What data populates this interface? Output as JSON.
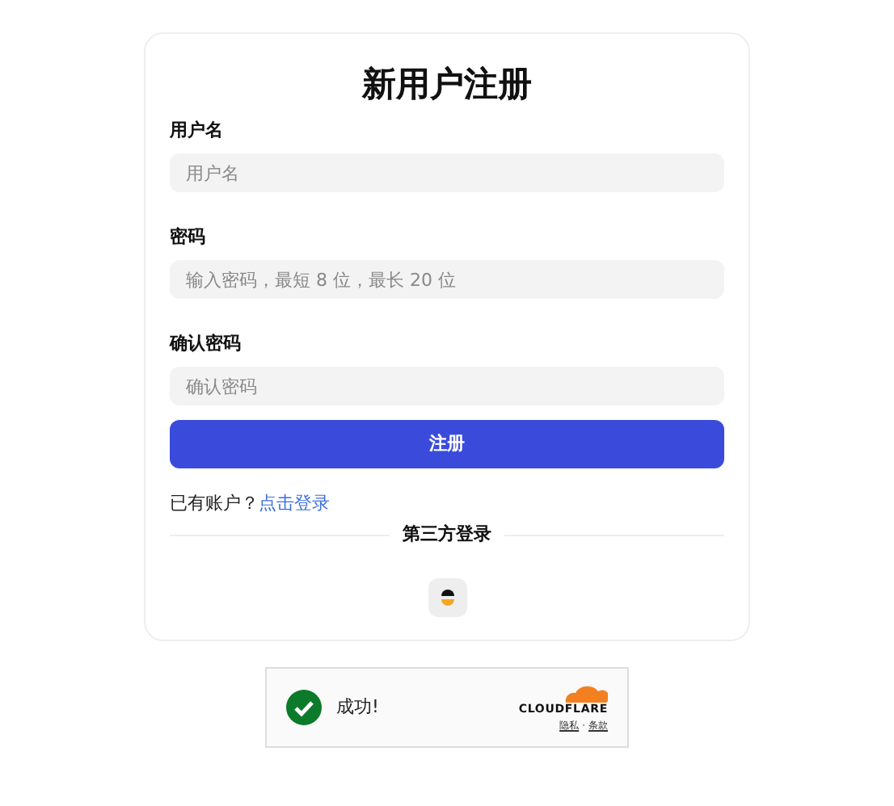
{
  "title": "新用户注册",
  "fields": [
    {
      "label": "用户名",
      "placeholder": "用户名"
    },
    {
      "label": "密码",
      "placeholder": "输入密码，最短 8 位，最长 20 位"
    },
    {
      "label": "确认密码",
      "placeholder": "确认密码"
    }
  ],
  "submit": "注册",
  "login_prompt": {
    "text": "已有账户？",
    "link": "点击登录"
  },
  "third_party": {
    "label": "第三方登录"
  },
  "captcha": {
    "status": "成功!",
    "brand": "CLOUDFLARE",
    "links": [
      "隐私",
      "条款"
    ],
    "separator": "·"
  }
}
